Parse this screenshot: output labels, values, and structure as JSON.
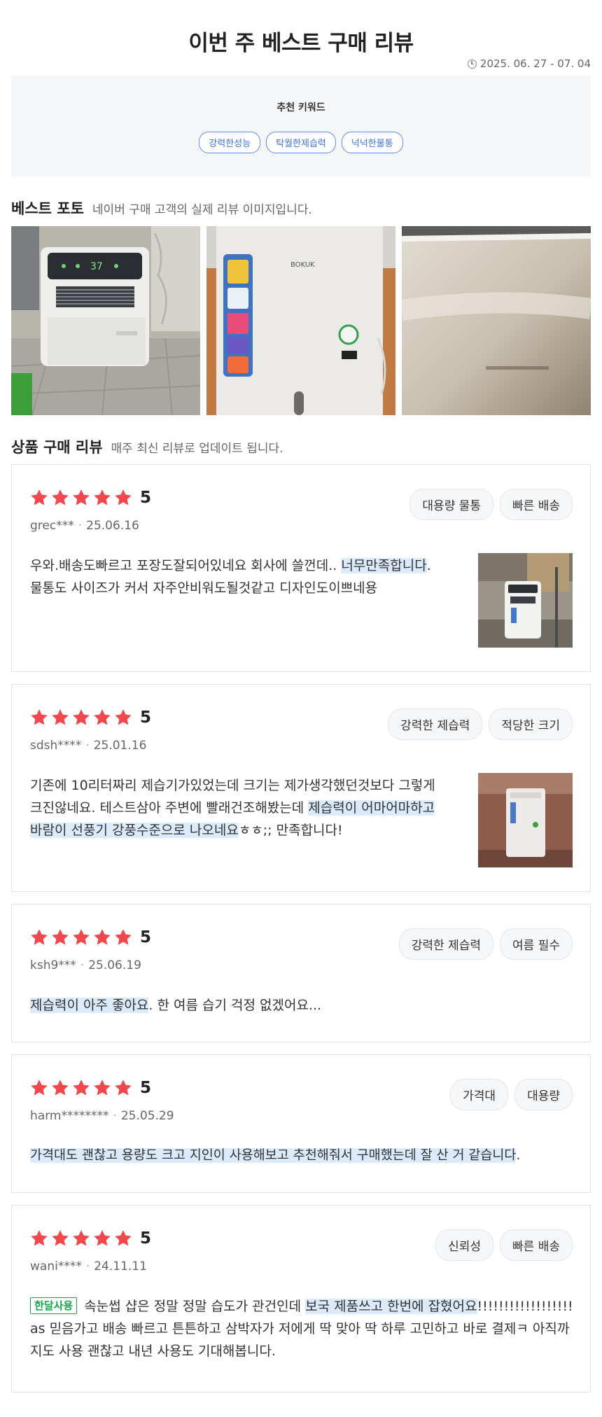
{
  "header": {
    "title": "이번 주 베스트 구매 리뷰",
    "period": "2025. 06. 27 - 07. 04"
  },
  "keywords": {
    "title": "추천 키워드",
    "tags": [
      "강력한성능",
      "탁월한제습력",
      "넉넉한물통"
    ]
  },
  "best_photo": {
    "title": "베스트 포토",
    "subtitle": "네이버 구매 고객의 실제 리뷰 이미지입니다."
  },
  "reviews_section": {
    "title": "상품 구매 리뷰",
    "subtitle": "매주 최신 리뷰로 업데이트 됩니다."
  },
  "colors": {
    "star": "#f0484d",
    "highlight": "#dcebfb",
    "keyword_blue": "#3f73d6",
    "badge_green": "#17a34a"
  },
  "reviews": [
    {
      "rating": "5",
      "user": "grec***",
      "date": "25.06.16",
      "tags": [
        "대용량 물통",
        "빠른 배송"
      ],
      "text": {
        "part1": "우와.배송도빠르고 포장도잘되어있네요 회사에 쓸껀데.. ",
        "hl1": "너무만족합니다",
        "part2": ".",
        "part3": "물통도 사이즈가 커서 자주안비워도될것같고 디자인도이쁘네용"
      }
    },
    {
      "rating": "5",
      "user": "sdsh****",
      "date": "25.01.16",
      "tags": [
        "강력한 제습력",
        "적당한 크기"
      ],
      "text": {
        "part1": "기존에 10리터짜리 제습기가있었는데 크기는 제가생각했던것보다 그렇게 크진않네요. 테스트삼아 주변에 빨래건조해봤는데 ",
        "hl1": "제습력이 어마어마하고 바람이 선풍기 강풍수준으로 나오네요",
        "part2": "ㅎㅎ;; 만족합니다!"
      }
    },
    {
      "rating": "5",
      "user": "ksh9***",
      "date": "25.06.19",
      "tags": [
        "강력한 제습력",
        "여름 필수"
      ],
      "text": {
        "hl1": "제습력이 아주 좋아요",
        "part1": ". 한 여름 습기 걱정 없겠어요..."
      }
    },
    {
      "rating": "5",
      "user": "harm********",
      "date": "25.05.29",
      "tags": [
        "가격대",
        "대용량"
      ],
      "text": {
        "hl1": "가격대도 괜찮고 용량도 크고 지인이 사용해보고 추천해줘서 구매했는데 잘 산 거 같습니다",
        "part1": "."
      }
    },
    {
      "rating": "5",
      "user": "wani****",
      "date": "24.11.11",
      "tags": [
        "신뢰성",
        "빠른 배송"
      ],
      "text": {
        "badge": "한달사용",
        "part1": "속눈썹 샵은 정말 정말 습도가 관건인데 ",
        "hl1": "보국 제품쓰고 한번에 잡혔어요",
        "part2": "!!!!!!!!!!!!!!!!!!as 믿음가고 배송 빠르고 튼튼하고 삼박자가 저에게 딱 맞아 딱 하루 고민하고 바로 결제ㅋ 아직까지도 사용 괜찮고 내년 사용도 기대해봅니다."
      }
    }
  ]
}
